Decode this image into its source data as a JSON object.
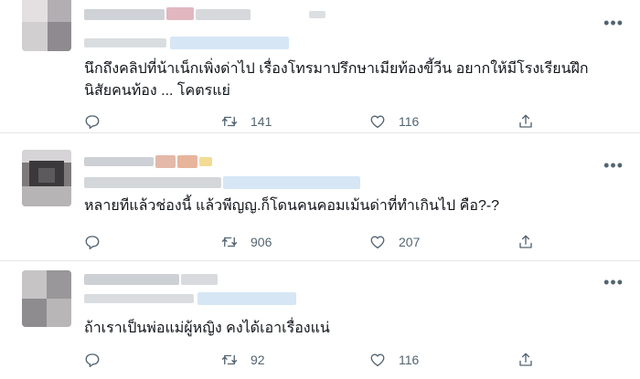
{
  "colors": {
    "text": "#0f1419",
    "muted": "#536471",
    "divider": "#e3e7ea",
    "blur_gray": "#d3d6da",
    "blur_blue": "#d6e6f5"
  },
  "tweets": [
    {
      "text_lines": [
        "นึกถึงคลิปที่น้าเน็กเพิ่งด่าไป เรื่องโทรมาปรึกษาเมียท้องขี้วีน อยากให้มีโรงเรียนฝึก",
        "นิสัยคนท้อง ... โคตรแย่"
      ],
      "retweets": "141",
      "likes": "116",
      "icons": [
        "reply-icon",
        "retweet-icon",
        "like-icon",
        "share-icon",
        "more-icon"
      ]
    },
    {
      "text_lines": [
        "หลายทีแล้วช่องนี้ แล้วพีญญ.ก็โดนคนคอมเม้นด่าที่ทำเกินไป  คือ?-?"
      ],
      "retweets": "906",
      "likes": "207",
      "icons": [
        "reply-icon",
        "retweet-icon",
        "like-icon",
        "share-icon",
        "more-icon"
      ]
    },
    {
      "text_lines": [
        "ถ้าเราเป็นพ่อแม่ผู้หญิง คงได้เอาเรื่องแน่"
      ],
      "retweets": "92",
      "likes": "116",
      "icons": [
        "reply-icon",
        "retweet-icon",
        "like-icon",
        "share-icon",
        "more-icon"
      ]
    }
  ]
}
